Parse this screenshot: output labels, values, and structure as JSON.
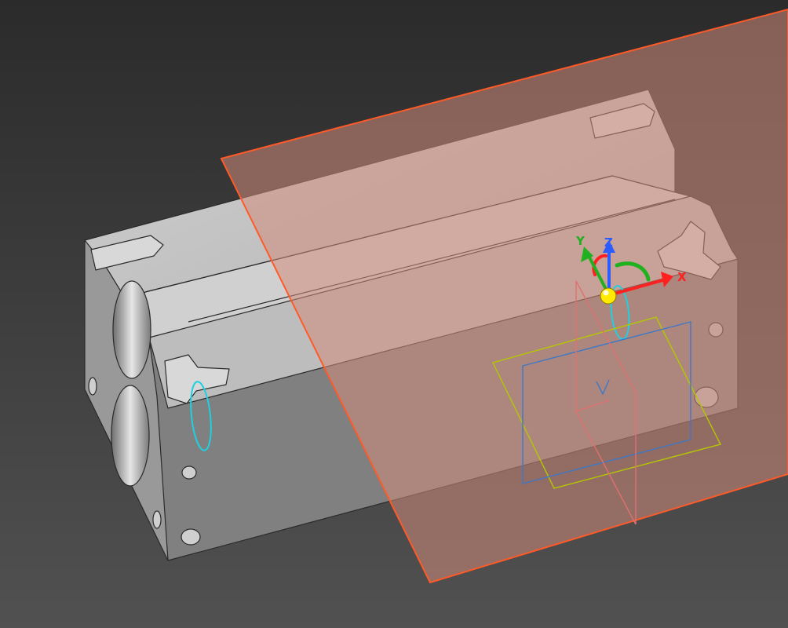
{
  "viewport": {
    "background_top": "#2b2b2b",
    "background_bottom": "#515151"
  },
  "colors": {
    "part_top": "#c4c4c4",
    "part_side": "#7f7f7f",
    "part_front": "#999999",
    "part_edge": "#2a2a2a",
    "section_plane_fill": "#d28c7a",
    "section_plane_edge": "#ff5a28",
    "circle_highlight": "#1fd0e0",
    "axis_x": "#ff2020",
    "axis_y": "#20b020",
    "axis_z": "#2a5cff",
    "origin_sphere": "#ffea00",
    "view_cube_yellow": "#b4c800",
    "view_cube_blue": "#3c78c8",
    "view_cube_pink": "#e07070"
  },
  "gizmo": {
    "x_label": "X",
    "y_label": "Y",
    "z_label": "Z"
  },
  "view_marker": {
    "label": "V"
  },
  "icons": {
    "triad": "xyz-triad-icon",
    "origin": "sphere-icon"
  }
}
